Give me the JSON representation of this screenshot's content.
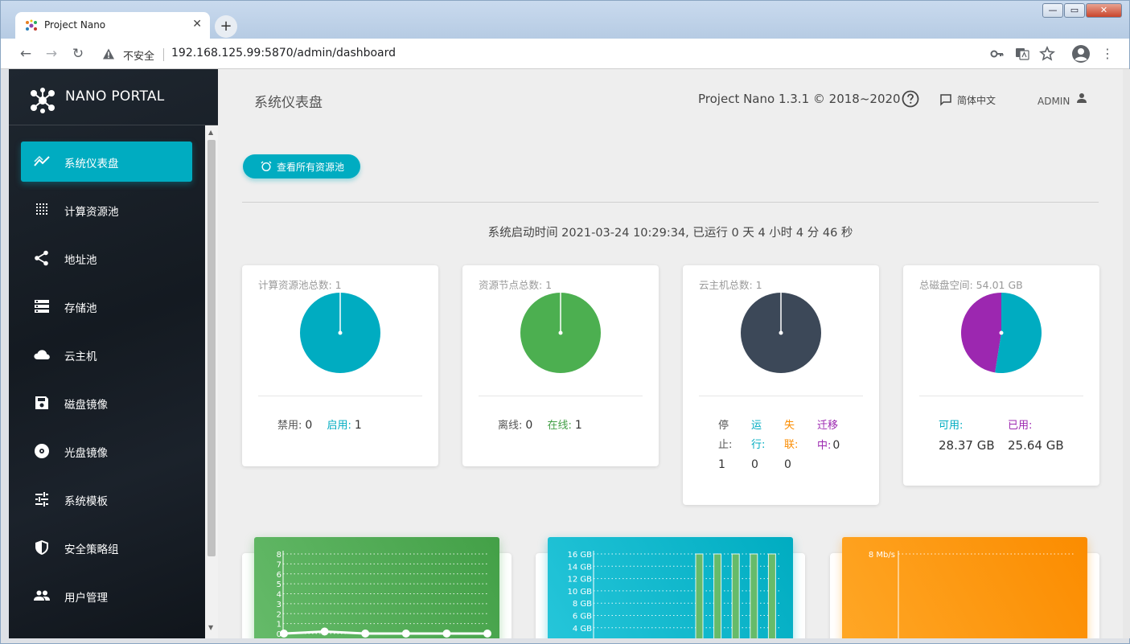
{
  "browser": {
    "tab_title": "Project Nano",
    "tab_close": "✕",
    "new_tab": "+",
    "security_label": "不安全",
    "url": "192.168.125.99:5870/admin/dashboard",
    "back": "←",
    "forward": "→",
    "reload": "↻",
    "menu": "⋮",
    "win_min": "—",
    "win_max": "▭",
    "win_close": "✕"
  },
  "sidebar": {
    "brand": "NANO PORTAL",
    "items": [
      {
        "label": "系统仪表盘",
        "icon": "trend-icon",
        "active": true
      },
      {
        "label": "计算资源池",
        "icon": "grid-dots-icon",
        "active": false
      },
      {
        "label": "地址池",
        "icon": "share-icon",
        "active": false
      },
      {
        "label": "存储池",
        "icon": "storage-list-icon",
        "active": false
      },
      {
        "label": "云主机",
        "icon": "cloud-icon",
        "active": false
      },
      {
        "label": "磁盘镜像",
        "icon": "save-disk-icon",
        "active": false
      },
      {
        "label": "光盘镜像",
        "icon": "disc-icon",
        "active": false
      },
      {
        "label": "系统模板",
        "icon": "tune-sliders-icon",
        "active": false
      },
      {
        "label": "安全策略组",
        "icon": "shield-icon",
        "active": false
      },
      {
        "label": "用户管理",
        "icon": "people-icon",
        "active": false
      }
    ]
  },
  "header": {
    "title": "系统仪表盘",
    "version": "Project Nano 1.3.1 © 2018~2020",
    "language": "简体中文",
    "user": "ADMIN"
  },
  "actions": {
    "view_pools": "查看所有资源池"
  },
  "uptime": "系统启动时间 2021-03-24 10:29:34, 已运行 0 天 4 小时 4 分 46 秒",
  "cards": {
    "pools": {
      "title": "计算资源池总数: 1",
      "color": "#00acc1",
      "disabled_label": "禁用:",
      "disabled_value": "0",
      "enabled_label": "启用:",
      "enabled_value": "1"
    },
    "nodes": {
      "title": "资源节点总数: 1",
      "color": "#4caf50",
      "offline_label": "离线:",
      "offline_value": "0",
      "online_label": "在线:",
      "online_value": "1"
    },
    "instances": {
      "title": "云主机总数: 1",
      "color": "#3c4858",
      "stopped_label_1": "停",
      "stopped_label_2": "止:",
      "stopped_value": "1",
      "running_label_1": "运",
      "running_label_2": "行:",
      "running_value": "0",
      "lost_label_1": "失",
      "lost_label_2": "联:",
      "lost_value": "0",
      "migrating_label_1": "迁移",
      "migrating_label_2": "中:",
      "migrating_value": "0"
    },
    "disk": {
      "title": "总磁盘空间: 54.01 GB",
      "available_label": "可用:",
      "available_value": "28.37 GB",
      "used_label": "已用:",
      "used_value": "25.64 GB",
      "available_color": "#00acc1",
      "used_color": "#9c27b0",
      "available_gb": 28.37,
      "used_gb": 25.64
    }
  },
  "chart_data": [
    {
      "type": "line",
      "color": "#4caf50",
      "y_ticks": [
        "8",
        "7",
        "6",
        "5",
        "4",
        "3",
        "2",
        "1",
        "0"
      ],
      "ylim": [
        0,
        8
      ],
      "values": [
        0,
        0.2,
        0,
        0,
        0,
        0
      ]
    },
    {
      "type": "bar",
      "color": "#00acc1",
      "y_ticks": [
        "16 GB",
        "14 GB",
        "12 GB",
        "10 GB",
        "8 GB",
        "6 GB",
        "4 GB"
      ],
      "ylim": [
        0,
        16
      ],
      "values": [
        0,
        0,
        0,
        0,
        0,
        0,
        0,
        0,
        0,
        0,
        0,
        0,
        16,
        16,
        16,
        16,
        16
      ]
    },
    {
      "type": "line",
      "color": "#fb8c00",
      "y_ticks": [
        "8 Mb/s"
      ],
      "ylim": [
        0,
        8
      ],
      "values": []
    }
  ]
}
